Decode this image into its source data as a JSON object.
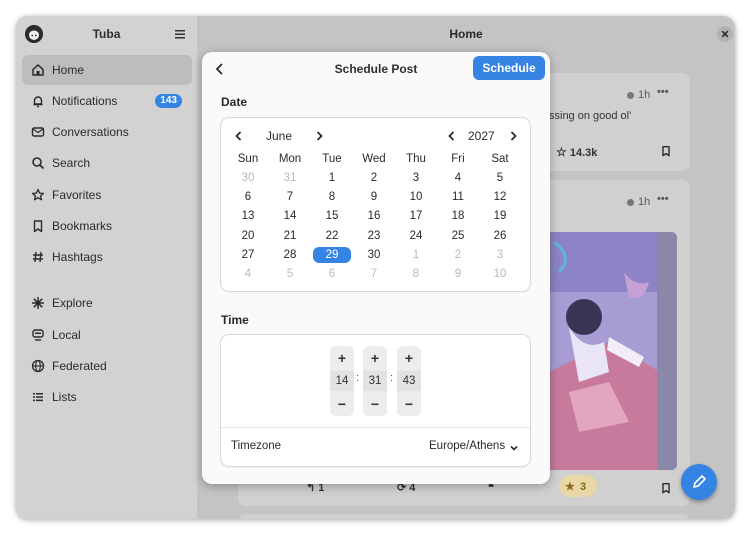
{
  "app": {
    "title": "Tuba"
  },
  "sidebar": {
    "items": [
      {
        "label": "Home",
        "icon": "home-icon",
        "active": true
      },
      {
        "label": "Notifications",
        "icon": "bell-icon",
        "badge": "143"
      },
      {
        "label": "Conversations",
        "icon": "mail-icon"
      },
      {
        "label": "Search",
        "icon": "search-icon"
      },
      {
        "label": "Favorites",
        "icon": "star-icon"
      },
      {
        "label": "Bookmarks",
        "icon": "bookmark-icon"
      },
      {
        "label": "Hashtags",
        "icon": "hashtag-icon"
      },
      {
        "label": "Explore",
        "icon": "explore-icon"
      },
      {
        "label": "Local",
        "icon": "local-icon"
      },
      {
        "label": "Federated",
        "icon": "globe-icon"
      },
      {
        "label": "Lists",
        "icon": "list-icon"
      }
    ]
  },
  "main": {
    "title": "Home",
    "posts": [
      {
        "time": "1h",
        "text": "ssing on good ol'",
        "favorites": "14.3k"
      },
      {
        "time": "1h",
        "replies": "1",
        "boosts": "4",
        "favorites": "3"
      }
    ]
  },
  "dialog": {
    "title": "Schedule Post",
    "schedule_label": "Schedule",
    "date_label": "Date",
    "time_label": "Time",
    "calendar": {
      "month": "June",
      "year": "2027",
      "weekdays": [
        "Sun",
        "Mon",
        "Tue",
        "Wed",
        "Thu",
        "Fri",
        "Sat"
      ],
      "weeks": [
        [
          "30",
          "31",
          "1",
          "2",
          "3",
          "4",
          "5"
        ],
        [
          "6",
          "7",
          "8",
          "9",
          "10",
          "11",
          "12"
        ],
        [
          "13",
          "14",
          "15",
          "16",
          "17",
          "18",
          "19"
        ],
        [
          "20",
          "21",
          "22",
          "23",
          "24",
          "25",
          "26"
        ],
        [
          "27",
          "28",
          "29",
          "30",
          "1",
          "2",
          "3"
        ],
        [
          "4",
          "5",
          "6",
          "7",
          "8",
          "9",
          "10"
        ]
      ],
      "selected": "29"
    },
    "time": {
      "hour": "14",
      "minute": "31",
      "second": "43",
      "plus": "+",
      "minus": "−",
      "separator": ":"
    },
    "timezone_label": "Timezone",
    "timezone_value": "Europe/Athens"
  },
  "colors": {
    "accent": "#3584e4",
    "sidebar_bg": "#d2d2d2",
    "favorite_star": "#e5a50a"
  }
}
